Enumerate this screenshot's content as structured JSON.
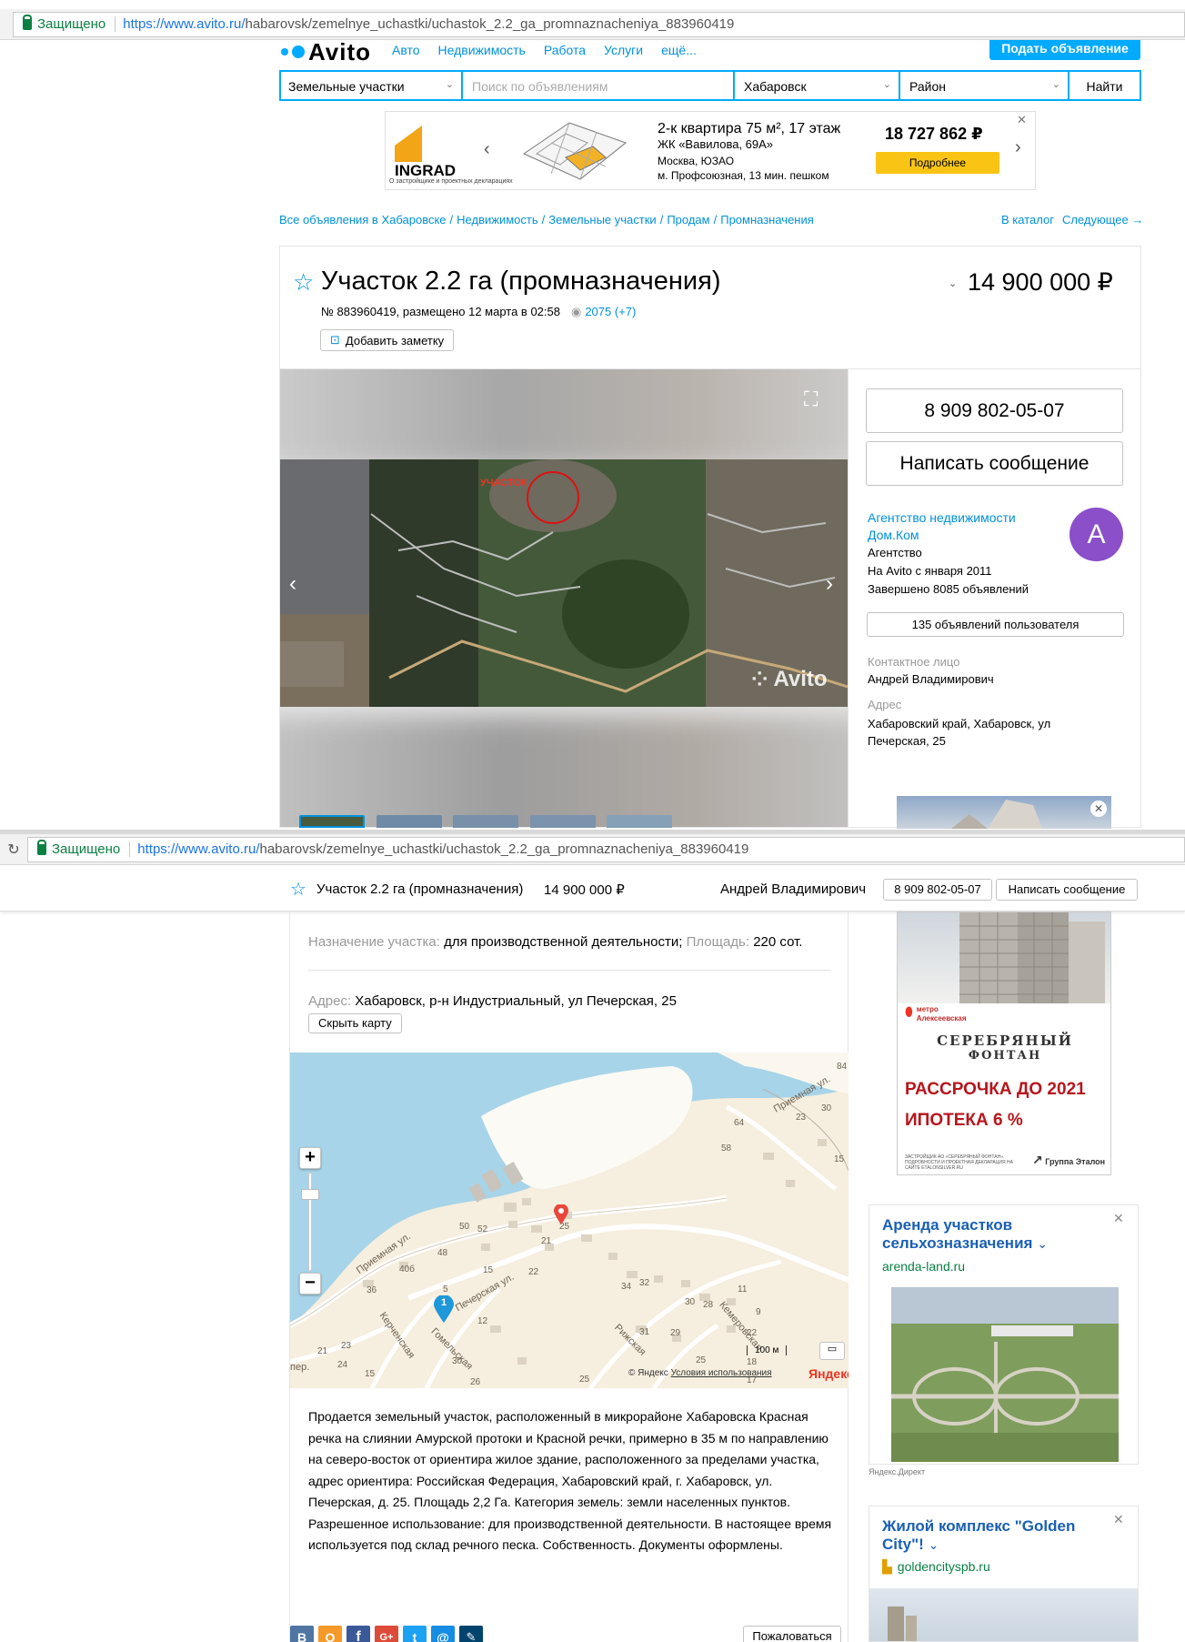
{
  "browser": {
    "secure_label": "Защищено",
    "url_host": "https://www.avito.ru/",
    "url_path": "habarovsk/zemelnye_uchastki/uchastok_2.2_ga_promnaznacheniya_883960419"
  },
  "header": {
    "logo": "Avito",
    "nav": [
      "Авто",
      "Недвижимость",
      "Работа",
      "Услуги",
      "ещё..."
    ],
    "post_button": "Подать объявление"
  },
  "search": {
    "category": "Земельные участки",
    "placeholder": "Поиск по объявлениям",
    "city": "Хабаровск",
    "district": "Район",
    "find_button": "Найти"
  },
  "banner": {
    "brand": "INGRAD",
    "brand_note": "О застройщике и проектных декларациях",
    "title": "2-к квартира 75 м², 17 этаж",
    "complex": "ЖК «Вавилова, 69А»",
    "city": "Москва, ЮЗАО",
    "metro": "м. Профсоюзная, 13 мин. пешком",
    "price": "18 727 862 ₽",
    "more_button": "Подробнее"
  },
  "breadcrumbs": {
    "items": [
      "Все объявления в Хабаровске",
      "Недвижимость",
      "Земельные участки",
      "Продам",
      "Промназначения"
    ],
    "catalog": "В каталог",
    "next": "Следующее →"
  },
  "listing": {
    "title": "Участок 2.2 га (промназначения)",
    "price": "14 900 000 ₽",
    "meta": "№ 883960419, размещено 12 марта в 02:58",
    "views": "2075 (+7)",
    "add_note": "Добавить заметку",
    "photo_watermark": "Avito",
    "photo_label": "УЧАСТОК"
  },
  "seller": {
    "phone": "8 909 802-05-07",
    "message_button": "Написать сообщение",
    "agency_name": "Агентство недвижимости Дом.Ком",
    "type": "Агентство",
    "since": "На Avito с января 2011",
    "completed": "Завершено 8085 объявлений",
    "ads_button": "135 объявлений пользователя",
    "contact_label": "Контактное лицо",
    "contact_name": "Андрей Владимирович",
    "address_label": "Адрес",
    "address_value": "Хабаровский край, Хабаровск, ул Печерская, 25",
    "avatar_letter": "A"
  },
  "sticky": {
    "title": "Участок 2.2 га (промназначения)",
    "price": "14 900 000 ₽",
    "contact": "Андрей Владимирович",
    "phone": "8 909 802-05-07",
    "message": "Написать сообщение"
  },
  "details": {
    "purpose_label": "Назначение участка:",
    "purpose_value": "для производственной деятельности;",
    "area_label": "Площадь:",
    "area_value": "220 сот.",
    "address_label": "Адрес:",
    "address_value": "Хабаровск, р-н Индустриальный, ул Печерская, 25",
    "hide_map": "Скрыть карту"
  },
  "map": {
    "streets": [
      "Приемная ул.",
      "Приемная ул.",
      "Печерская ул.",
      "Керченская",
      "Гомельская",
      "Рижская",
      "Кемеровская",
      "пер."
    ],
    "houses": [
      "84",
      "30",
      "23",
      "64",
      "58",
      "15",
      "50",
      "52",
      "25",
      "21",
      "48",
      "40б",
      "15",
      "22",
      "36",
      "34",
      "32",
      "11",
      "30",
      "28",
      "9",
      "12",
      "3",
      "5",
      "21",
      "23",
      "24",
      "15",
      "30",
      "26",
      "31",
      "29",
      "25",
      "22",
      "18",
      "17",
      "25"
    ],
    "scale": "100 м",
    "copyright": "© Яндекс",
    "terms": "Условия использования",
    "brand": "Яндекс",
    "cluster_count": "1",
    "zoom_in": "+",
    "zoom_out": "−"
  },
  "description": "Продается земельный участок, расположенный в микрорайоне Хабаровска Красная речка на слиянии Амурской протоки и Красной речки, примерно в 35 м по направлению на северо-восток от ориентира жилое здание, расположенного за пределами участка, адрес ориентира: Российская Федерация, Хабаровский край, г. Хабаровск, ул. Печерская, д. 25. Площадь 2,2 Га. Категория земель: земли населенных пунктов. Разрешенное использование: для производственной деятельности. В настоящее время используется под склад речного песка. Собственность. Документы оформлены.",
  "share": {
    "icons": [
      "vk-icon",
      "ok-icon",
      "facebook-icon",
      "googleplus-icon",
      "twitter-icon",
      "mailru-icon",
      "lj-icon"
    ],
    "icon_letters": [
      "В",
      "О",
      "f",
      "G+",
      "t",
      "@",
      "✎"
    ],
    "complain": "Пожаловаться"
  },
  "ads": {
    "silver": {
      "metro_label": "метро",
      "metro_name": "Алексеевская",
      "title_line1": "СЕРЕБРЯНЫЙ",
      "title_line2": "ФОНТАН",
      "offer1": "РАССРОЧКА ДО 2021",
      "offer2_prefix": "ИПОТЕКА",
      "offer2_value": "6 %",
      "fine_print": "ЗАСТРОЙЩИК АО «СЕРЕБРЯНЫЙ ФОНТАН». ПОДРОБНОСТИ И ПРОЕКТНАЯ ДЕКЛАРАЦИЯ НА САЙТЕ ETALONSILVER.RU",
      "group": "Группа Эталон"
    },
    "direct1": {
      "title": "Аренда участков сельхозназначения",
      "domain": "arenda-land.ru",
      "footer": "Яндекс.Директ"
    },
    "direct2": {
      "title": "Жилой комплекс \"Golden City\"!",
      "domain": "goldencityspb.ru"
    }
  },
  "colors": {
    "link": "#0091d9",
    "avatar": "#8a4fc9",
    "accent_yellow": "#f9c414",
    "post_button": "#00aaff"
  }
}
